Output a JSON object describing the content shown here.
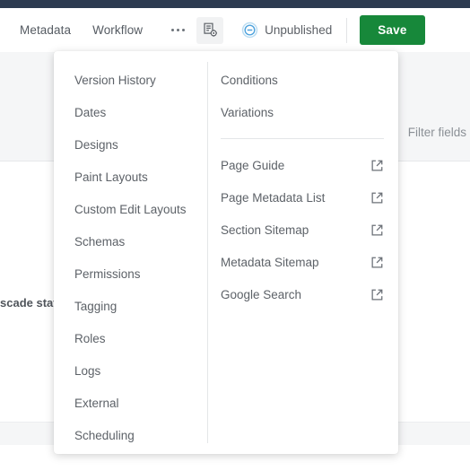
{
  "toolbar": {
    "tabs": [
      {
        "label": "Metadata",
        "name": "tab-metadata"
      },
      {
        "label": "Workflow",
        "name": "tab-workflow"
      }
    ],
    "more_icon": "ellipsis-icon",
    "page_settings_icon": "page-settings-icon",
    "status": {
      "label": "Unpublished",
      "icon": "unpublished-circle-icon",
      "color": "#5aa9dd"
    },
    "save_label": "Save",
    "save_color": "#17883a"
  },
  "background": {
    "filter_fields_label": "Filter fields",
    "cascade_text": "scade stat"
  },
  "menu": {
    "left_items": [
      {
        "label": "Version History"
      },
      {
        "label": "Dates"
      },
      {
        "label": "Designs"
      },
      {
        "label": "Paint Layouts"
      },
      {
        "label": "Custom Edit Layouts"
      },
      {
        "label": "Schemas"
      },
      {
        "label": "Permissions"
      },
      {
        "label": "Tagging"
      },
      {
        "label": "Roles"
      },
      {
        "label": "Logs"
      },
      {
        "label": "External"
      },
      {
        "label": "Scheduling"
      }
    ],
    "right_items_top": [
      {
        "label": "Conditions"
      },
      {
        "label": "Variations"
      }
    ],
    "right_items_bottom": [
      {
        "label": "Page Guide",
        "icon": "external-link-icon"
      },
      {
        "label": "Page Metadata List",
        "icon": "external-link-icon"
      },
      {
        "label": "Section Sitemap",
        "icon": "external-link-icon"
      },
      {
        "label": "Metadata Sitemap",
        "icon": "external-link-icon"
      },
      {
        "label": "Google Search",
        "icon": "external-link-icon"
      }
    ]
  }
}
